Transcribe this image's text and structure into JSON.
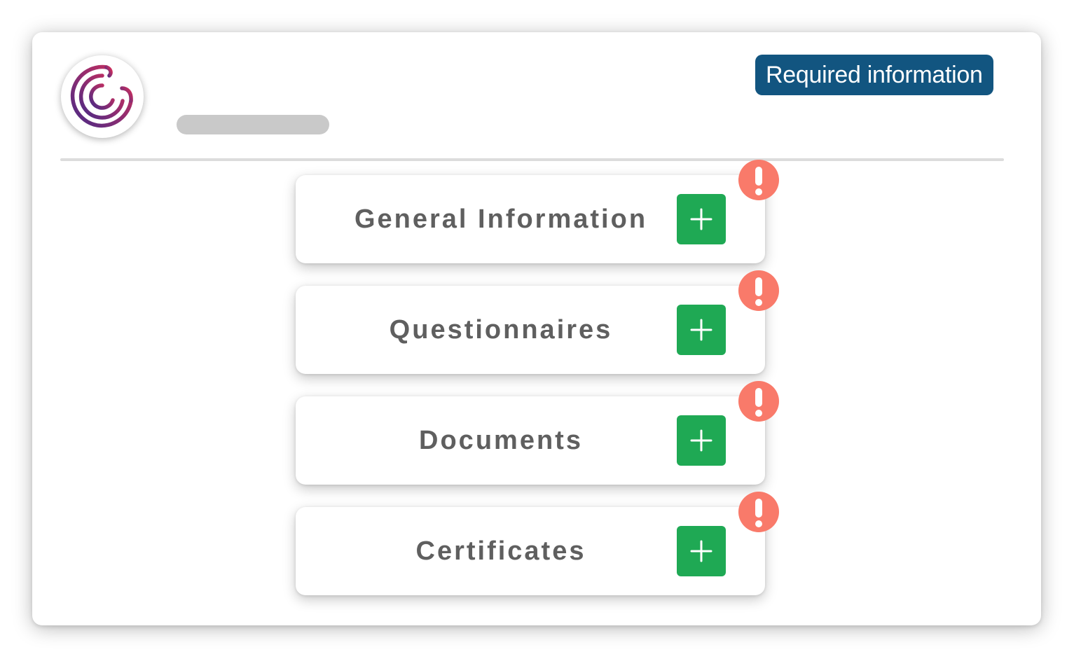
{
  "header": {
    "logo_icon": "spiral-logo-icon",
    "required_badge_label": "Required information",
    "badge_color": "#125580"
  },
  "sections": [
    {
      "label": "General Information",
      "action_icon": "plus-icon",
      "status_icon": "exclamation-alert-icon"
    },
    {
      "label": "Questionnaires",
      "action_icon": "plus-icon",
      "status_icon": "exclamation-alert-icon"
    },
    {
      "label": "Documents",
      "action_icon": "plus-icon",
      "status_icon": "exclamation-alert-icon"
    },
    {
      "label": "Certificates",
      "action_icon": "plus-icon",
      "status_icon": "exclamation-alert-icon"
    }
  ],
  "colors": {
    "add_button": "#1fa954",
    "alert": "#f97a6a",
    "section_text": "#5f5f5f",
    "logo_gradient_start": "#d62f5a",
    "logo_gradient_end": "#4a2a86"
  }
}
